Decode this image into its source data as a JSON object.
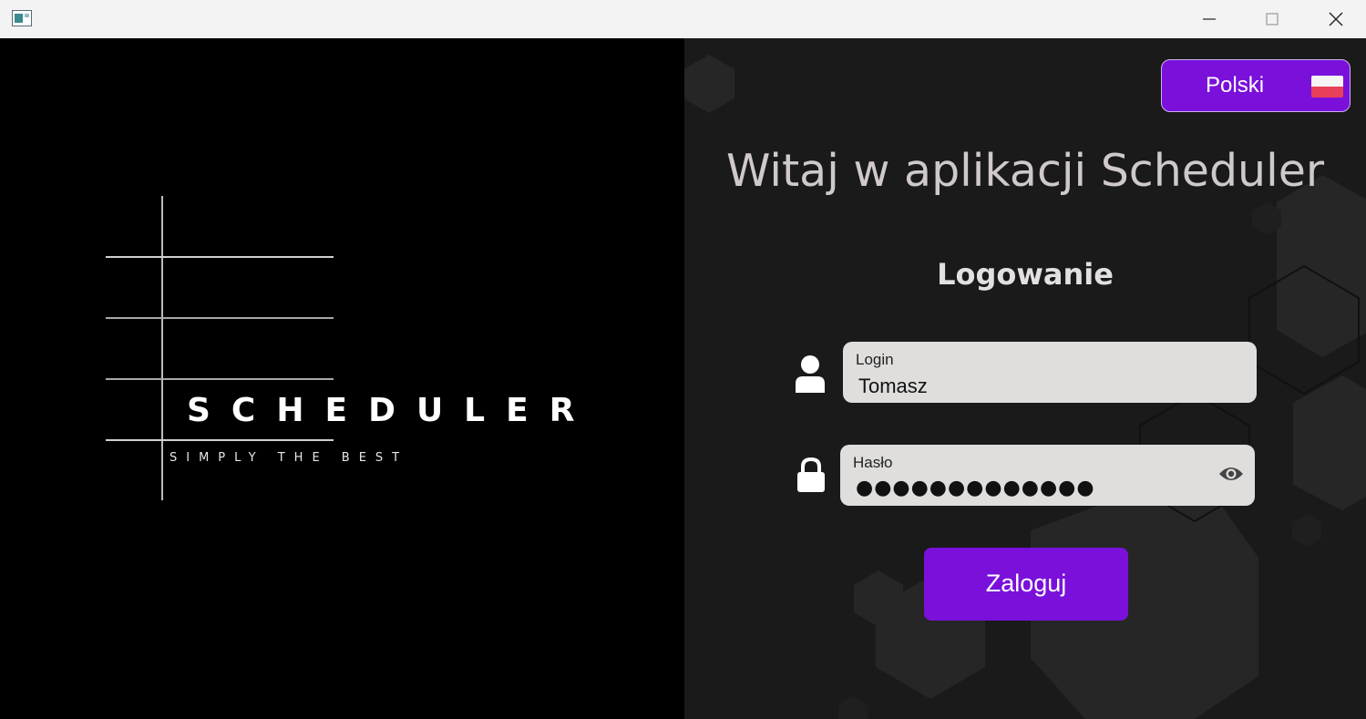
{
  "window": {
    "controls": [
      "minimize",
      "maximize",
      "close"
    ]
  },
  "logo": {
    "wordmark": "SCHEDULER",
    "tagline": "SIMPLY THE BEST"
  },
  "language": {
    "label": "Polski",
    "flag": "poland-flag"
  },
  "welcome_title": "Witaj w aplikacji Scheduler",
  "section_title": "Logowanie",
  "login_field": {
    "label": "Login",
    "value": "Tomasz",
    "icon": "user-icon"
  },
  "password_field": {
    "label": "Hasło",
    "masked_value": "●●●●●●●●●●●●●",
    "icon": "lock-icon",
    "toggle_icon": "eye-icon"
  },
  "submit_label": "Zaloguj",
  "colors": {
    "accent": "#7a10da",
    "background_left": "#000000",
    "background_right": "#1a1a1a",
    "field_bg": "#dfdedd"
  }
}
